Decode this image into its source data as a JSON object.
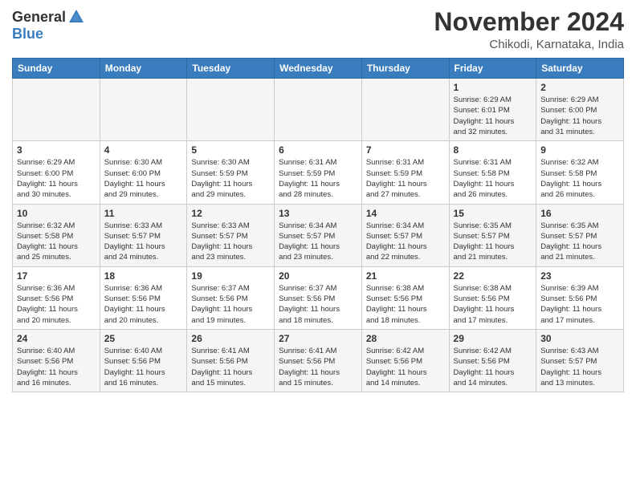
{
  "header": {
    "logo_general": "General",
    "logo_blue": "Blue",
    "month_title": "November 2024",
    "subtitle": "Chikodi, Karnataka, India"
  },
  "weekdays": [
    "Sunday",
    "Monday",
    "Tuesday",
    "Wednesday",
    "Thursday",
    "Friday",
    "Saturday"
  ],
  "weeks": [
    [
      {
        "day": "",
        "info": ""
      },
      {
        "day": "",
        "info": ""
      },
      {
        "day": "",
        "info": ""
      },
      {
        "day": "",
        "info": ""
      },
      {
        "day": "",
        "info": ""
      },
      {
        "day": "1",
        "info": "Sunrise: 6:29 AM\nSunset: 6:01 PM\nDaylight: 11 hours\nand 32 minutes."
      },
      {
        "day": "2",
        "info": "Sunrise: 6:29 AM\nSunset: 6:00 PM\nDaylight: 11 hours\nand 31 minutes."
      }
    ],
    [
      {
        "day": "3",
        "info": "Sunrise: 6:29 AM\nSunset: 6:00 PM\nDaylight: 11 hours\nand 30 minutes."
      },
      {
        "day": "4",
        "info": "Sunrise: 6:30 AM\nSunset: 6:00 PM\nDaylight: 11 hours\nand 29 minutes."
      },
      {
        "day": "5",
        "info": "Sunrise: 6:30 AM\nSunset: 5:59 PM\nDaylight: 11 hours\nand 29 minutes."
      },
      {
        "day": "6",
        "info": "Sunrise: 6:31 AM\nSunset: 5:59 PM\nDaylight: 11 hours\nand 28 minutes."
      },
      {
        "day": "7",
        "info": "Sunrise: 6:31 AM\nSunset: 5:59 PM\nDaylight: 11 hours\nand 27 minutes."
      },
      {
        "day": "8",
        "info": "Sunrise: 6:31 AM\nSunset: 5:58 PM\nDaylight: 11 hours\nand 26 minutes."
      },
      {
        "day": "9",
        "info": "Sunrise: 6:32 AM\nSunset: 5:58 PM\nDaylight: 11 hours\nand 26 minutes."
      }
    ],
    [
      {
        "day": "10",
        "info": "Sunrise: 6:32 AM\nSunset: 5:58 PM\nDaylight: 11 hours\nand 25 minutes."
      },
      {
        "day": "11",
        "info": "Sunrise: 6:33 AM\nSunset: 5:57 PM\nDaylight: 11 hours\nand 24 minutes."
      },
      {
        "day": "12",
        "info": "Sunrise: 6:33 AM\nSunset: 5:57 PM\nDaylight: 11 hours\nand 23 minutes."
      },
      {
        "day": "13",
        "info": "Sunrise: 6:34 AM\nSunset: 5:57 PM\nDaylight: 11 hours\nand 23 minutes."
      },
      {
        "day": "14",
        "info": "Sunrise: 6:34 AM\nSunset: 5:57 PM\nDaylight: 11 hours\nand 22 minutes."
      },
      {
        "day": "15",
        "info": "Sunrise: 6:35 AM\nSunset: 5:57 PM\nDaylight: 11 hours\nand 21 minutes."
      },
      {
        "day": "16",
        "info": "Sunrise: 6:35 AM\nSunset: 5:57 PM\nDaylight: 11 hours\nand 21 minutes."
      }
    ],
    [
      {
        "day": "17",
        "info": "Sunrise: 6:36 AM\nSunset: 5:56 PM\nDaylight: 11 hours\nand 20 minutes."
      },
      {
        "day": "18",
        "info": "Sunrise: 6:36 AM\nSunset: 5:56 PM\nDaylight: 11 hours\nand 20 minutes."
      },
      {
        "day": "19",
        "info": "Sunrise: 6:37 AM\nSunset: 5:56 PM\nDaylight: 11 hours\nand 19 minutes."
      },
      {
        "day": "20",
        "info": "Sunrise: 6:37 AM\nSunset: 5:56 PM\nDaylight: 11 hours\nand 18 minutes."
      },
      {
        "day": "21",
        "info": "Sunrise: 6:38 AM\nSunset: 5:56 PM\nDaylight: 11 hours\nand 18 minutes."
      },
      {
        "day": "22",
        "info": "Sunrise: 6:38 AM\nSunset: 5:56 PM\nDaylight: 11 hours\nand 17 minutes."
      },
      {
        "day": "23",
        "info": "Sunrise: 6:39 AM\nSunset: 5:56 PM\nDaylight: 11 hours\nand 17 minutes."
      }
    ],
    [
      {
        "day": "24",
        "info": "Sunrise: 6:40 AM\nSunset: 5:56 PM\nDaylight: 11 hours\nand 16 minutes."
      },
      {
        "day": "25",
        "info": "Sunrise: 6:40 AM\nSunset: 5:56 PM\nDaylight: 11 hours\nand 16 minutes."
      },
      {
        "day": "26",
        "info": "Sunrise: 6:41 AM\nSunset: 5:56 PM\nDaylight: 11 hours\nand 15 minutes."
      },
      {
        "day": "27",
        "info": "Sunrise: 6:41 AM\nSunset: 5:56 PM\nDaylight: 11 hours\nand 15 minutes."
      },
      {
        "day": "28",
        "info": "Sunrise: 6:42 AM\nSunset: 5:56 PM\nDaylight: 11 hours\nand 14 minutes."
      },
      {
        "day": "29",
        "info": "Sunrise: 6:42 AM\nSunset: 5:56 PM\nDaylight: 11 hours\nand 14 minutes."
      },
      {
        "day": "30",
        "info": "Sunrise: 6:43 AM\nSunset: 5:57 PM\nDaylight: 11 hours\nand 13 minutes."
      }
    ]
  ]
}
